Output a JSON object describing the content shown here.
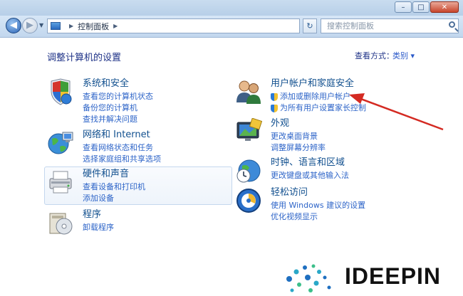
{
  "navbar": {
    "breadcrumb": "控制面板",
    "search_placeholder": "搜索控制面板"
  },
  "header": {
    "title": "调整计算机的设置",
    "view_by_label": "查看方式：",
    "view_by_value": "类别"
  },
  "categories": [
    {
      "id": "system-security",
      "title": "系统和安全",
      "links": [
        "查看您的计算机状态",
        "备份您的计算机",
        "查找并解决问题"
      ]
    },
    {
      "id": "network-internet",
      "title": "网络和 Internet",
      "links": [
        "查看网络状态和任务",
        "选择家庭组和共享选项"
      ]
    },
    {
      "id": "hardware-sound",
      "title": "硬件和声音",
      "links": [
        "查看设备和打印机",
        "添加设备"
      ]
    },
    {
      "id": "programs",
      "title": "程序",
      "links": [
        "卸载程序"
      ]
    },
    {
      "id": "user-accounts",
      "title": "用户帐户和家庭安全",
      "links": [
        "添加或删除用户帐户",
        "为所有用户设置家长控制"
      ]
    },
    {
      "id": "appearance",
      "title": "外观",
      "links": [
        "更改桌面背景",
        "调整屏幕分辨率"
      ]
    },
    {
      "id": "clock-language",
      "title": "时钟、语言和区域",
      "links": [
        "更改键盘或其他输入法"
      ]
    },
    {
      "id": "ease-access",
      "title": "轻松访问",
      "links": [
        "使用 Windows 建议的设置",
        "优化视频显示"
      ]
    }
  ],
  "watermark": {
    "text": "IDEEPIN"
  },
  "colors": {
    "title": "#1e3287",
    "link": "#2d64c8",
    "category": "#12508f",
    "arrow": "#d42a22"
  }
}
